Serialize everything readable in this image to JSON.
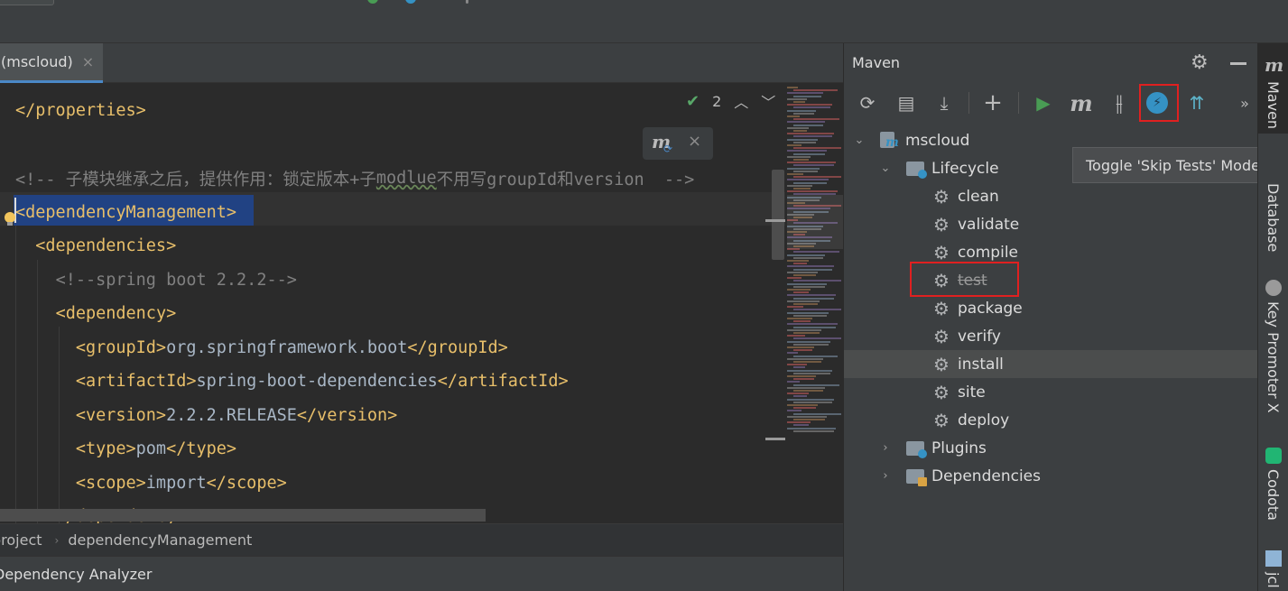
{
  "editor": {
    "tab_label": "(mscloud)",
    "close_glyph": "×",
    "inspection_count": "2",
    "code_lines": [
      [
        {
          "c": "tag",
          "t": "</properties>"
        }
      ],
      [],
      [
        {
          "c": "cmt",
          "t": "<!-- 子模块继承之后，提供作用：锁定版本+子"
        },
        {
          "c": "cmt-squig",
          "t": "modlue"
        },
        {
          "c": "cmt",
          "t": "不用写groupId和version  -->"
        }
      ],
      [
        {
          "c": "tag",
          "t": "<dependencyManagement>"
        }
      ],
      [
        {
          "c": "ws",
          "t": "  "
        },
        {
          "c": "tag",
          "t": "<dependencies>"
        }
      ],
      [
        {
          "c": "ws",
          "t": "    "
        },
        {
          "c": "cmt",
          "t": "<!--spring boot 2.2.2-->"
        }
      ],
      [
        {
          "c": "ws",
          "t": "    "
        },
        {
          "c": "tag",
          "t": "<dependency>"
        }
      ],
      [
        {
          "c": "ws",
          "t": "      "
        },
        {
          "c": "tag",
          "t": "<groupId>"
        },
        {
          "c": "txt",
          "t": "org.springframework.boot"
        },
        {
          "c": "tag",
          "t": "</groupId>"
        }
      ],
      [
        {
          "c": "ws",
          "t": "      "
        },
        {
          "c": "tag",
          "t": "<artifactId>"
        },
        {
          "c": "txt",
          "t": "spring-boot-dependencies"
        },
        {
          "c": "tag",
          "t": "</artifactId>"
        }
      ],
      [
        {
          "c": "ws",
          "t": "      "
        },
        {
          "c": "tag",
          "t": "<version>"
        },
        {
          "c": "txt",
          "t": "2.2.2.RELEASE"
        },
        {
          "c": "tag",
          "t": "</version>"
        }
      ],
      [
        {
          "c": "ws",
          "t": "      "
        },
        {
          "c": "tag",
          "t": "<type>"
        },
        {
          "c": "txt",
          "t": "pom"
        },
        {
          "c": "tag",
          "t": "</type>"
        }
      ],
      [
        {
          "c": "ws",
          "t": "      "
        },
        {
          "c": "tag",
          "t": "<scope>"
        },
        {
          "c": "txt",
          "t": "import"
        },
        {
          "c": "tag",
          "t": "</scope>"
        }
      ],
      [
        {
          "c": "ws",
          "t": "    "
        },
        {
          "c": "tag",
          "t": "</dependency>"
        }
      ]
    ]
  },
  "breadcrumb": {
    "items": [
      "project",
      "dependencyManagement"
    ]
  },
  "bottom_tool": {
    "label": "Dependency Analyzer"
  },
  "maven": {
    "title": "Maven",
    "toolbar": [
      {
        "name": "reload-all-icon",
        "glyph": "⟳"
      },
      {
        "name": "reload-folder-icon",
        "glyph": "▤"
      },
      {
        "name": "download-sources-icon",
        "glyph": "⤓"
      },
      {
        "name": "add-project-icon",
        "glyph": "+"
      },
      {
        "name": "run-icon",
        "glyph": "▶"
      },
      {
        "name": "execute-goal-icon",
        "glyph": "m"
      },
      {
        "name": "toggle-offline-icon",
        "glyph": "⫲"
      },
      {
        "name": "skip-tests-icon",
        "glyph": "⚡"
      },
      {
        "name": "show-dependencies-icon",
        "glyph": "⇈"
      },
      {
        "name": "more-icon",
        "glyph": "»"
      }
    ],
    "tree": {
      "project": "mscloud",
      "lifecycle": "Lifecycle",
      "goals": [
        "clean",
        "validate",
        "compile",
        "test",
        "package",
        "verify",
        "install",
        "site",
        "deploy"
      ],
      "plugins": "Plugins",
      "dependencies": "Dependencies"
    },
    "tooltip": "Toggle 'Skip Tests' Mode"
  },
  "stripe": {
    "items": [
      "Maven",
      "Database",
      "Key Promoter X",
      "Codota",
      "jcl"
    ]
  },
  "colors": {
    "accent": "#4a88c7",
    "highlight_box": "#e02020",
    "run_green": "#499c54"
  }
}
